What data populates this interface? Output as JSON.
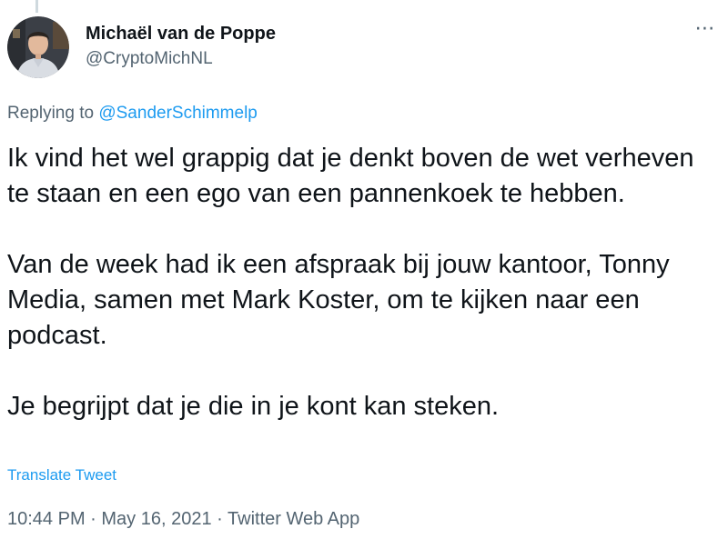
{
  "tweet": {
    "author": {
      "display_name": "Michaël van de Poppe",
      "handle": "@CryptoMichNL"
    },
    "more_icon": "⋯",
    "reply": {
      "prefix": "Replying to ",
      "mention": "@SanderSchimmelp"
    },
    "paragraphs": [
      "Ik vind het wel grappig dat je denkt boven de wet verheven te staan en een ego van een pannenkoek te hebben.",
      "Van de week had ik een afspraak bij jouw kantoor, Tonny Media, samen met Mark Koster, om te kijken naar een podcast.",
      "Je begrijpt dat je die in je kont kan steken."
    ],
    "translate_label": "Translate Tweet",
    "meta": {
      "time": "10:44 PM",
      "separator": " · ",
      "date": "May 16, 2021",
      "source": "Twitter Web App"
    }
  },
  "colors": {
    "text_primary": "#0f1419",
    "text_secondary": "#536471",
    "link": "#1d9bf0"
  }
}
